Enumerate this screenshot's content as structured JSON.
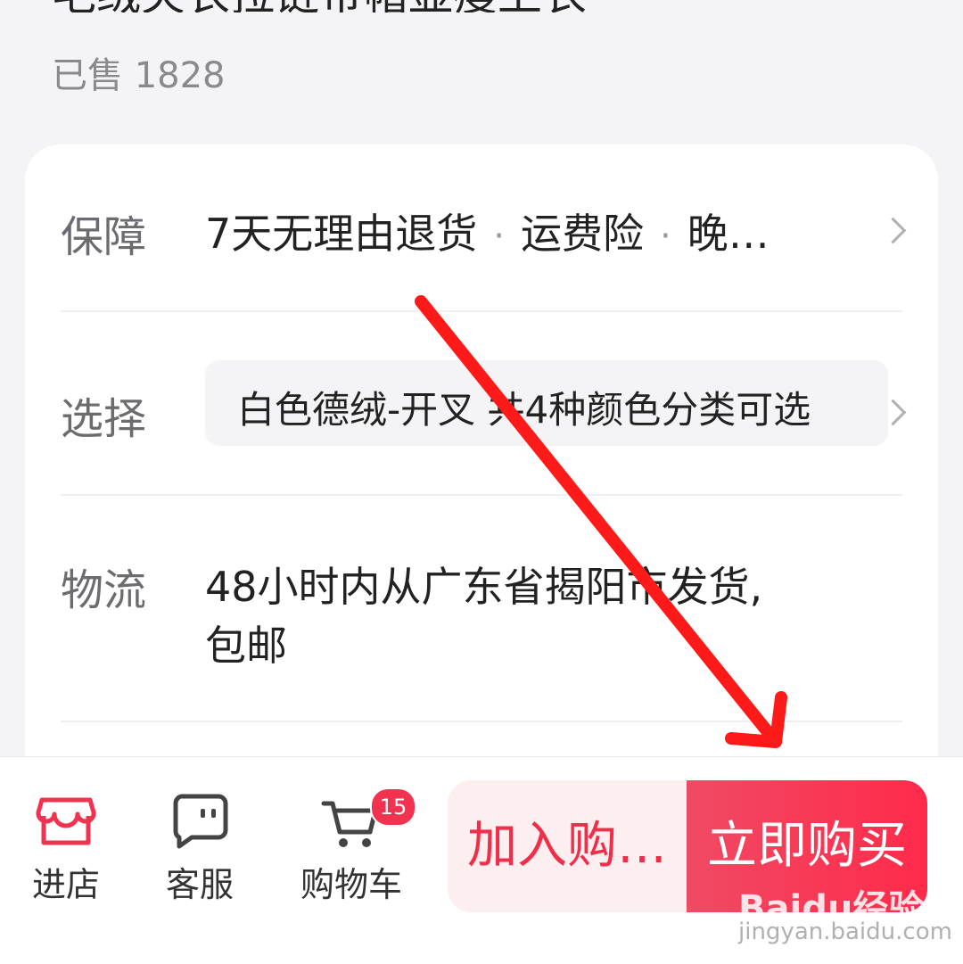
{
  "product": {
    "title": "毛绒夹衣拉链带帽显瘦上衣",
    "sold": "已售 1828"
  },
  "details": {
    "guarantee": {
      "label": "保障",
      "items": [
        "7天无理由退货",
        "运费险",
        "晚…"
      ]
    },
    "select": {
      "label": "选择",
      "value": "白色德绒-开叉 共4种颜色分类可选"
    },
    "logistics": {
      "label": "物流",
      "line1": "48小时内从广东省揭阳市发货,",
      "line2": "包邮"
    }
  },
  "bottom_bar": {
    "nav": [
      {
        "label": "进店",
        "icon": "store-icon"
      },
      {
        "label": "客服",
        "icon": "chat-icon"
      },
      {
        "label": "购物车",
        "icon": "cart-icon",
        "badge": "15"
      }
    ],
    "add_to_cart": "加入购…",
    "buy_now": "立即购买"
  },
  "watermark": {
    "brand": "Baidu经验",
    "url": "jingyan.baidu.com"
  },
  "colors": {
    "accent": "#f23350",
    "arrow": "#ff1a1a"
  }
}
